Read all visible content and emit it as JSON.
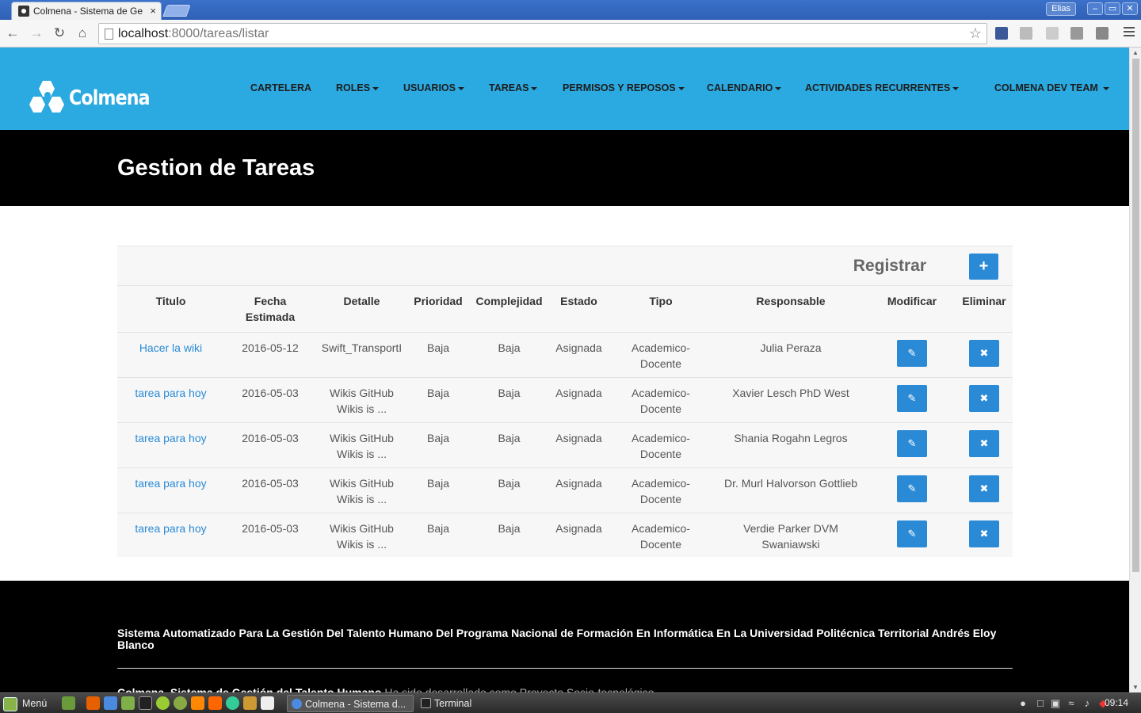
{
  "browser": {
    "tab_title": "Colmena - Sistema de Ge",
    "tab_close": "×",
    "user": "Elias",
    "window_buttons": [
      "–",
      "▭",
      "✕"
    ],
    "url_host": "localhost",
    "url_rest": ":8000/tareas/listar"
  },
  "site": {
    "brand": "Colmena",
    "nav": [
      {
        "label": "CARTELERA",
        "dropdown": false
      },
      {
        "label": "ROLES",
        "dropdown": true
      },
      {
        "label": "USUARIOS",
        "dropdown": true
      },
      {
        "label": "TAREAS",
        "dropdown": true
      },
      {
        "label": "PERMISOS Y REPOSOS",
        "dropdown": true
      },
      {
        "label": "CALENDARIO",
        "dropdown": true
      },
      {
        "label": "ACTIVIDADES RECURRENTES",
        "dropdown": true
      },
      {
        "label": "COLMENA DEV TEAM",
        "dropdown": true
      }
    ],
    "page_title": "Gestion de Tareas"
  },
  "panel": {
    "register_label": "Registrar",
    "register_button": "+"
  },
  "table": {
    "headers": {
      "titulo": "Titulo",
      "fecha_1": "Fecha",
      "fecha_2": "Estimada",
      "detalle": "Detalle",
      "prioridad": "Prioridad",
      "complejidad": "Complejidad",
      "estado": "Estado",
      "tipo": "Tipo",
      "responsable": "Responsable",
      "modificar": "Modificar",
      "eliminar": "Eliminar"
    },
    "rows": [
      {
        "titulo": "Hacer la wiki",
        "fecha": "2016-05-12",
        "detalle_1": "Swift_TransportI",
        "detalle_2": "",
        "prioridad": "Baja",
        "complejidad": "Baja",
        "estado": "Asignada",
        "tipo_1": "Academico-",
        "tipo_2": "Docente",
        "responsable_1": "Julia Peraza",
        "responsable_2": ""
      },
      {
        "titulo": "tarea para hoy",
        "fecha": "2016-05-03",
        "detalle_1": "Wikis GitHub",
        "detalle_2": "Wikis is ...",
        "prioridad": "Baja",
        "complejidad": "Baja",
        "estado": "Asignada",
        "tipo_1": "Academico-",
        "tipo_2": "Docente",
        "responsable_1": "Xavier Lesch PhD West",
        "responsable_2": ""
      },
      {
        "titulo": "tarea para hoy",
        "fecha": "2016-05-03",
        "detalle_1": "Wikis GitHub",
        "detalle_2": "Wikis is ...",
        "prioridad": "Baja",
        "complejidad": "Baja",
        "estado": "Asignada",
        "tipo_1": "Academico-",
        "tipo_2": "Docente",
        "responsable_1": "Shania Rogahn Legros",
        "responsable_2": ""
      },
      {
        "titulo": "tarea para hoy",
        "fecha": "2016-05-03",
        "detalle_1": "Wikis GitHub",
        "detalle_2": "Wikis is ...",
        "prioridad": "Baja",
        "complejidad": "Baja",
        "estado": "Asignada",
        "tipo_1": "Academico-",
        "tipo_2": "Docente",
        "responsable_1": "Dr. Murl Halvorson Gottlieb",
        "responsable_2": ""
      },
      {
        "titulo": "tarea para hoy",
        "fecha": "2016-05-03",
        "detalle_1": "Wikis GitHub",
        "detalle_2": "Wikis is ...",
        "prioridad": "Baja",
        "complejidad": "Baja",
        "estado": "Asignada",
        "tipo_1": "Academico-",
        "tipo_2": "Docente",
        "responsable_1": "Verdie Parker DVM",
        "responsable_2": "Swaniawski"
      }
    ],
    "edit_glyph": "✎",
    "delete_glyph": "✖"
  },
  "footer": {
    "title": "Sistema Automatizado Para La Gestión Del Talento Humano Del Programa Nacional de Formación En Informática En La Universidad Politécnica Territorial Andrés Eloy Blanco",
    "credit_bold": "Colmena, Sistema de Gestión del Talento Humano",
    "credit_rest": " Ha sido desarrollado como Proyecto Socio-tecnológico"
  },
  "taskbar": {
    "menu_label": "Menú",
    "tasks": [
      "Colmena - Sistema d...",
      "Terminal"
    ],
    "clock": "09:14"
  },
  "colors": {
    "nav_bg": "#2ba9e1",
    "accent": "#2a8ad6",
    "header_bg": "#000000"
  },
  "icons": [
    "back-icon",
    "forward-icon",
    "reload-icon",
    "home-icon",
    "star-icon",
    "menu-icon",
    "plus-icon",
    "pencil-icon",
    "times-icon",
    "logo-hexagons-icon"
  ]
}
